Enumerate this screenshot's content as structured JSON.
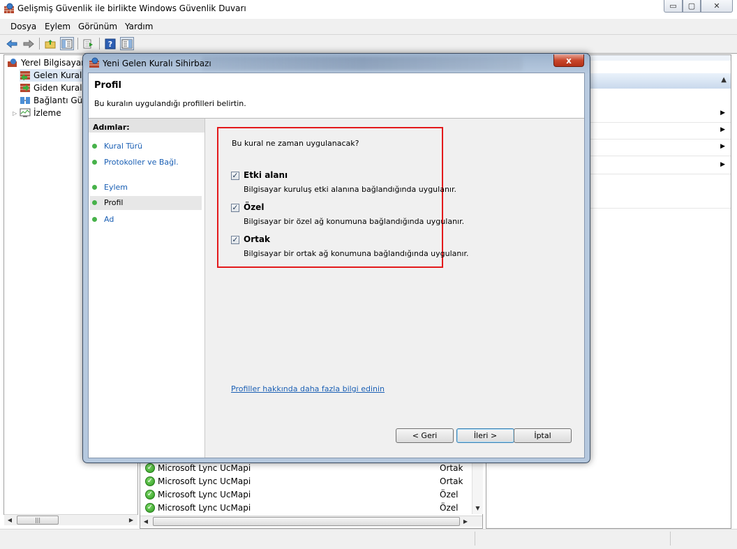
{
  "window": {
    "title": "Gelişmiş Güvenlik ile birlikte Windows Güvenlik Duvarı",
    "minimize": "▭",
    "maximize": "▢",
    "close": "✕"
  },
  "menu": [
    "Dosya",
    "Eylem",
    "Görünüm",
    "Yardım"
  ],
  "tree": {
    "root": "Yerel Bilgisayar ü",
    "items": [
      "Gelen Kuralla",
      "Giden Kuralla",
      "Bağlantı Güv",
      "İzleme"
    ]
  },
  "rules": [
    {
      "name": "Microsoft Lync UcMapi",
      "profile": "Ortak"
    },
    {
      "name": "Microsoft Lync UcMapi",
      "profile": "Ortak"
    },
    {
      "name": "Microsoft Lync UcMapi",
      "profile": "Özel"
    },
    {
      "name": "Microsoft Lync UcMapi",
      "profile": "Özel"
    }
  ],
  "dialog": {
    "title": "Yeni Gelen Kuralı Sihirbazı",
    "close": "x",
    "heading": "Profil",
    "description": "Bu kuralın uygulandığı profilleri belirtin.",
    "steps_title": "Adımlar:",
    "steps": [
      "Kural Türü",
      "Protokoller ve Bağl. Noktaları",
      "Eylem",
      "Profil",
      "Ad"
    ],
    "active_step": 3,
    "question": "Bu kural ne zaman uygulanacak?",
    "options": [
      {
        "label": "Etki alanı",
        "description": "Bilgisayar kuruluş etki alanına bağlandığında uygulanır.",
        "checked": true
      },
      {
        "label": "Özel",
        "description": "Bilgisayar bir özel ağ konumuna bağlandığında uygulanır.",
        "checked": true
      },
      {
        "label": "Ortak",
        "description": "Bilgisayar bir ortak ağ konumuna bağlandığında uygulanır.",
        "checked": true
      }
    ],
    "link": "Profiller hakkında daha fazla bilgi edinin",
    "buttons": {
      "back": "< Geri",
      "next": "İleri >",
      "cancel": "İptal"
    }
  },
  "colors": {
    "highlight": "#e3191b",
    "link": "#1a5fb4",
    "step_dot": "#47b24a"
  }
}
